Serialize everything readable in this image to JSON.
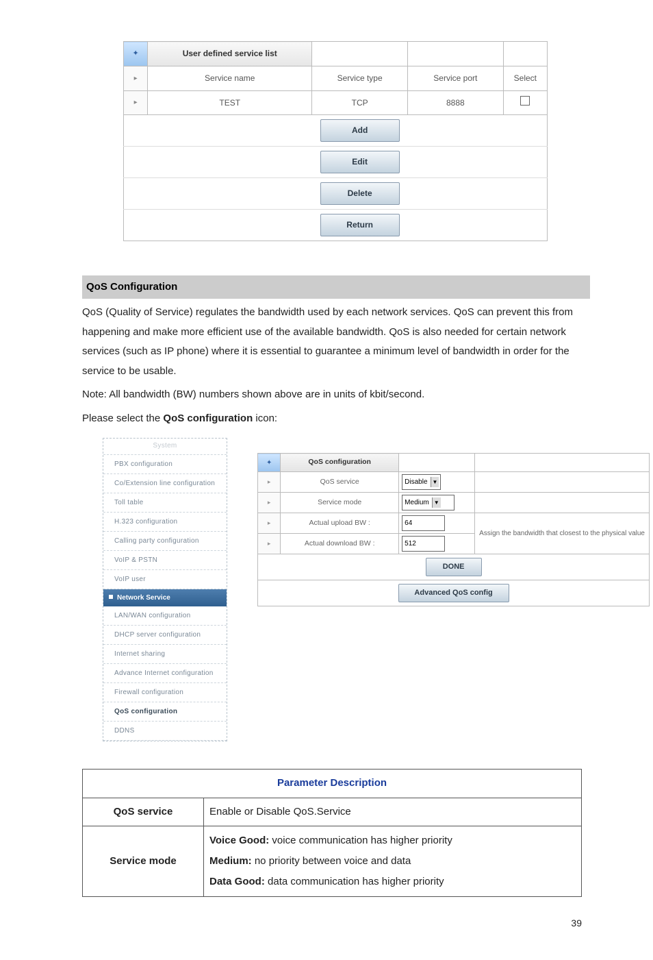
{
  "udsl": {
    "title": "User defined service list",
    "cols": {
      "name": "Service name",
      "type": "Service type",
      "port": "Service port",
      "select": "Select"
    },
    "row": {
      "name": "TEST",
      "type": "TCP",
      "port": "8888"
    },
    "buttons": {
      "add": "Add",
      "edit": "Edit",
      "delete": "Delete",
      "return": "Return"
    }
  },
  "section": {
    "title": "QoS Configuration",
    "p1": "QoS (Quality of Service) regulates the bandwidth used by each network services. QoS can prevent this from happening and make more efficient use of the available bandwidth. QoS is also needed for certain network services (such as IP phone) where it is essential to guarantee a minimum level of bandwidth in order for the service to be usable.",
    "p2": "Note: All bandwidth (BW) numbers shown above are in units of kbit/second.",
    "p3_pre": "Please select the ",
    "p3_bold": "QoS configuration",
    "p3_post": " icon:"
  },
  "menu": {
    "cut": "System",
    "items1": [
      "PBX configuration",
      "Co/Extension line configuration",
      "Toll table",
      "H.323 configuration",
      "Calling party configuration",
      "VoIP & PSTN",
      "VoIP user"
    ],
    "cat": "Network Service",
    "items2": [
      "LAN/WAN configuration",
      "DHCP server configuration",
      "Internet sharing",
      "Advance Internet configuration",
      "Firewall configuration",
      "QoS configuration",
      "DDNS"
    ],
    "active": "QoS configuration"
  },
  "qos_panel": {
    "title": "QoS configuration",
    "rows": {
      "service_lbl": "QoS service",
      "service_val": "Disable",
      "mode_lbl": "Service mode",
      "mode_val": "Medium",
      "up_lbl": "Actual upload BW :",
      "up_val": "64",
      "down_lbl": "Actual download BW :",
      "down_val": "512",
      "hint": "Assign the bandwidth that closest to the physical value"
    },
    "buttons": {
      "done": "DONE",
      "adv": "Advanced QoS config"
    }
  },
  "param": {
    "title": "Parameter Description",
    "r1_k": "QoS service",
    "r1_v": "Enable or Disable QoS.Service",
    "r2_k": "Service mode",
    "r2_v1b": "Voice Good:",
    "r2_v1": " voice communication has higher priority",
    "r2_v2b": "Medium:",
    "r2_v2": " no priority between voice and data",
    "r2_v3b": "Data Good:",
    "r2_v3": " data communication has higher priority"
  },
  "page": "39"
}
